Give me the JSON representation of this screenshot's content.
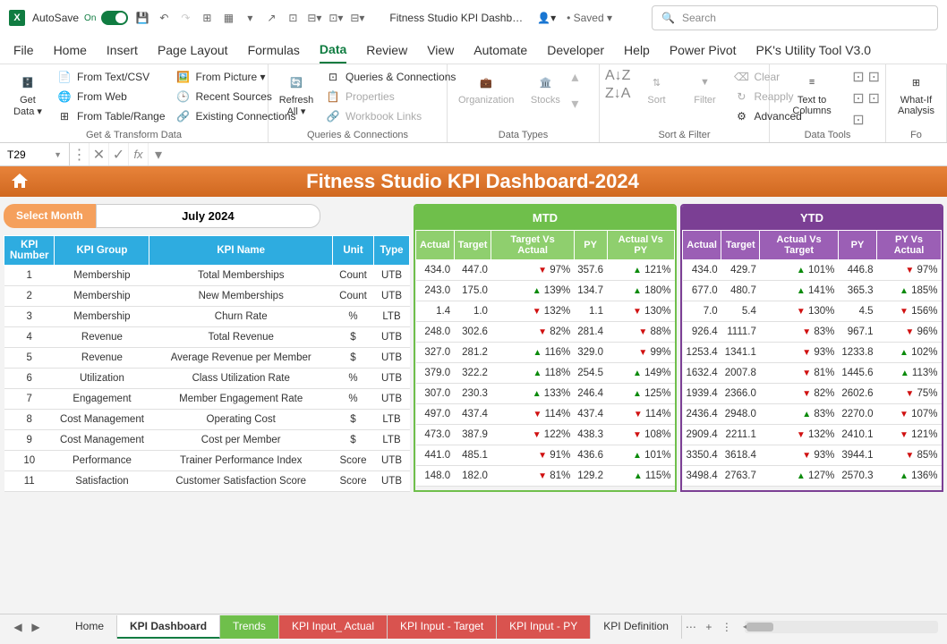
{
  "titlebar": {
    "autosave_label": "AutoSave",
    "autosave_state": "On",
    "doc_title": "Fitness Studio KPI Dashb…",
    "saved": "• Saved ▾",
    "search_placeholder": "Search"
  },
  "ribbon_tabs": [
    "File",
    "Home",
    "Insert",
    "Page Layout",
    "Formulas",
    "Data",
    "Review",
    "View",
    "Automate",
    "Developer",
    "Help",
    "Power Pivot",
    "PK's Utility Tool V3.0"
  ],
  "active_tab": "Data",
  "ribbon": {
    "get_data": "Get Data ▾",
    "from_text": "From Text/CSV",
    "from_web": "From Web",
    "from_table": "From Table/Range",
    "from_picture": "From Picture ▾",
    "recent_sources": "Recent Sources",
    "existing_conn": "Existing Connections",
    "grp_get": "Get & Transform Data",
    "refresh_all": "Refresh All ▾",
    "queries_conn": "Queries & Connections",
    "properties": "Properties",
    "workbook_links": "Workbook Links",
    "grp_queries": "Queries & Connections",
    "organization": "Organization",
    "stocks": "Stocks",
    "grp_types": "Data Types",
    "sort": "Sort",
    "filter": "Filter",
    "clear": "Clear",
    "reapply": "Reapply",
    "advanced": "Advanced",
    "grp_sort": "Sort & Filter",
    "text_cols": "Text to Columns",
    "whatif": "What-If Analysis",
    "grp_tools": "Data Tools",
    "grp_fo": "Fo"
  },
  "name_box": "T29",
  "dash": {
    "title": "Fitness Studio KPI Dashboard-2024",
    "select_month_label": "Select Month",
    "month_value": "July 2024",
    "mtd_label": "MTD",
    "ytd_label": "YTD"
  },
  "kpi_headers": {
    "num": "KPI Number",
    "group": "KPI Group",
    "name": "KPI Name",
    "unit": "Unit",
    "type": "Type"
  },
  "mtd_headers": [
    "Actual",
    "Target",
    "Target Vs Actual",
    "PY",
    "Actual Vs PY"
  ],
  "ytd_headers": [
    "Actual",
    "Target",
    "Actual Vs Target",
    "PY",
    "PY Vs Actual"
  ],
  "kpis": [
    {
      "num": 1,
      "group": "Membership",
      "name": "Total Memberships",
      "unit": "Count",
      "type": "UTB",
      "m": {
        "a": "434.0",
        "t": "447.0",
        "tv": "97%",
        "tvd": "down",
        "py": "357.6",
        "pv": "121%",
        "pvd": "up"
      },
      "y": {
        "a": "434.0",
        "t": "429.7",
        "tv": "101%",
        "tvd": "up",
        "py": "446.8",
        "pv": "97%",
        "pvd": "down"
      }
    },
    {
      "num": 2,
      "group": "Membership",
      "name": "New Memberships",
      "unit": "Count",
      "type": "UTB",
      "m": {
        "a": "243.0",
        "t": "175.0",
        "tv": "139%",
        "tvd": "up",
        "py": "134.7",
        "pv": "180%",
        "pvd": "up"
      },
      "y": {
        "a": "677.0",
        "t": "480.7",
        "tv": "141%",
        "tvd": "up",
        "py": "365.3",
        "pv": "185%",
        "pvd": "up"
      }
    },
    {
      "num": 3,
      "group": "Membership",
      "name": "Churn Rate",
      "unit": "%",
      "type": "LTB",
      "m": {
        "a": "1.4",
        "t": "1.0",
        "tv": "132%",
        "tvd": "down",
        "py": "1.1",
        "pv": "130%",
        "pvd": "down"
      },
      "y": {
        "a": "7.0",
        "t": "5.4",
        "tv": "130%",
        "tvd": "down",
        "py": "4.5",
        "pv": "156%",
        "pvd": "down"
      }
    },
    {
      "num": 4,
      "group": "Revenue",
      "name": "Total Revenue",
      "unit": "$",
      "type": "UTB",
      "m": {
        "a": "248.0",
        "t": "302.6",
        "tv": "82%",
        "tvd": "down",
        "py": "281.4",
        "pv": "88%",
        "pvd": "down"
      },
      "y": {
        "a": "926.4",
        "t": "1111.7",
        "tv": "83%",
        "tvd": "down",
        "py": "967.1",
        "pv": "96%",
        "pvd": "down"
      }
    },
    {
      "num": 5,
      "group": "Revenue",
      "name": "Average Revenue per Member",
      "unit": "$",
      "type": "UTB",
      "m": {
        "a": "327.0",
        "t": "281.2",
        "tv": "116%",
        "tvd": "up",
        "py": "329.0",
        "pv": "99%",
        "pvd": "down"
      },
      "y": {
        "a": "1253.4",
        "t": "1341.1",
        "tv": "93%",
        "tvd": "down",
        "py": "1233.8",
        "pv": "102%",
        "pvd": "up"
      }
    },
    {
      "num": 6,
      "group": "Utilization",
      "name": "Class Utilization Rate",
      "unit": "%",
      "type": "UTB",
      "m": {
        "a": "379.0",
        "t": "322.2",
        "tv": "118%",
        "tvd": "up",
        "py": "254.5",
        "pv": "149%",
        "pvd": "up"
      },
      "y": {
        "a": "1632.4",
        "t": "2007.8",
        "tv": "81%",
        "tvd": "down",
        "py": "1445.6",
        "pv": "113%",
        "pvd": "up"
      }
    },
    {
      "num": 7,
      "group": "Engagement",
      "name": "Member Engagement Rate",
      "unit": "%",
      "type": "UTB",
      "m": {
        "a": "307.0",
        "t": "230.3",
        "tv": "133%",
        "tvd": "up",
        "py": "246.4",
        "pv": "125%",
        "pvd": "up"
      },
      "y": {
        "a": "1939.4",
        "t": "2366.0",
        "tv": "82%",
        "tvd": "down",
        "py": "2602.6",
        "pv": "75%",
        "pvd": "down"
      }
    },
    {
      "num": 8,
      "group": "Cost Management",
      "name": "Operating Cost",
      "unit": "$",
      "type": "LTB",
      "m": {
        "a": "497.0",
        "t": "437.4",
        "tv": "114%",
        "tvd": "down",
        "py": "437.4",
        "pv": "114%",
        "pvd": "down"
      },
      "y": {
        "a": "2436.4",
        "t": "2948.0",
        "tv": "83%",
        "tvd": "up",
        "py": "2270.0",
        "pv": "107%",
        "pvd": "down"
      }
    },
    {
      "num": 9,
      "group": "Cost Management",
      "name": "Cost per Member",
      "unit": "$",
      "type": "LTB",
      "m": {
        "a": "473.0",
        "t": "387.9",
        "tv": "122%",
        "tvd": "down",
        "py": "438.3",
        "pv": "108%",
        "pvd": "down"
      },
      "y": {
        "a": "2909.4",
        "t": "2211.1",
        "tv": "132%",
        "tvd": "down",
        "py": "2410.1",
        "pv": "121%",
        "pvd": "down"
      }
    },
    {
      "num": 10,
      "group": "Performance",
      "name": "Trainer Performance Index",
      "unit": "Score",
      "type": "UTB",
      "m": {
        "a": "441.0",
        "t": "485.1",
        "tv": "91%",
        "tvd": "down",
        "py": "436.6",
        "pv": "101%",
        "pvd": "up"
      },
      "y": {
        "a": "3350.4",
        "t": "3618.4",
        "tv": "93%",
        "tvd": "down",
        "py": "3944.1",
        "pv": "85%",
        "pvd": "down"
      }
    },
    {
      "num": 11,
      "group": "Satisfaction",
      "name": "Customer Satisfaction Score",
      "unit": "Score",
      "type": "UTB",
      "m": {
        "a": "148.0",
        "t": "182.0",
        "tv": "81%",
        "tvd": "down",
        "py": "129.2",
        "pv": "115%",
        "pvd": "up"
      },
      "y": {
        "a": "3498.4",
        "t": "2763.7",
        "tv": "127%",
        "tvd": "up",
        "py": "2570.3",
        "pv": "136%",
        "pvd": "up"
      }
    }
  ],
  "sheet_tabs": [
    {
      "label": "Home",
      "color": ""
    },
    {
      "label": "KPI Dashboard",
      "color": "",
      "active": true
    },
    {
      "label": "Trends",
      "color": "#6fbf4b"
    },
    {
      "label": "KPI Input_ Actual",
      "color": "#d9534f"
    },
    {
      "label": "KPI Input - Target",
      "color": "#d9534f"
    },
    {
      "label": "KPI Input - PY",
      "color": "#d9534f"
    },
    {
      "label": "KPI Definition",
      "color": ""
    }
  ]
}
